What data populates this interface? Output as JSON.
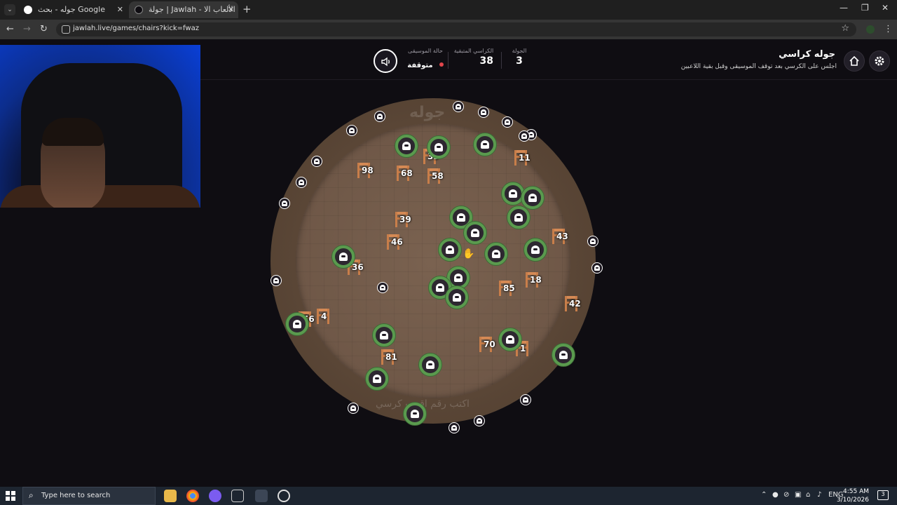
{
  "browser": {
    "tabs": [
      {
        "title": "جوله - بحث Google",
        "active": false
      },
      {
        "title": "جولة | Jawlah - منصة الألعاب الا...",
        "active": true
      }
    ],
    "url": "jawlah.live/games/chairs?kick=fwaz"
  },
  "game": {
    "title": "جوله كراسي",
    "subtitle": "اجلس على الكرسي بعد توقف الموسيقى وقبل بقية اللاعبين",
    "round_label": "الجولة",
    "round_value": "3",
    "chairs_label": "الكراسي المتبقية",
    "chairs_value": "38",
    "music_label": "حالة الموسيقى",
    "music_value": "متوقفة",
    "watermark_top": "جوله",
    "watermark_bottom": "اكتب رقم اقرب كرسي",
    "chairs": [
      "33",
      "11",
      "98",
      "68",
      "58",
      "39",
      "43",
      "46",
      "36",
      "18",
      "85",
      "42",
      "56",
      "4",
      "70",
      "1",
      "81"
    ]
  },
  "taskbar": {
    "search_placeholder": "Type here to search",
    "lang": "ENG",
    "time": "4:55 AM",
    "date": "3/10/2026",
    "notification_count": "3"
  }
}
